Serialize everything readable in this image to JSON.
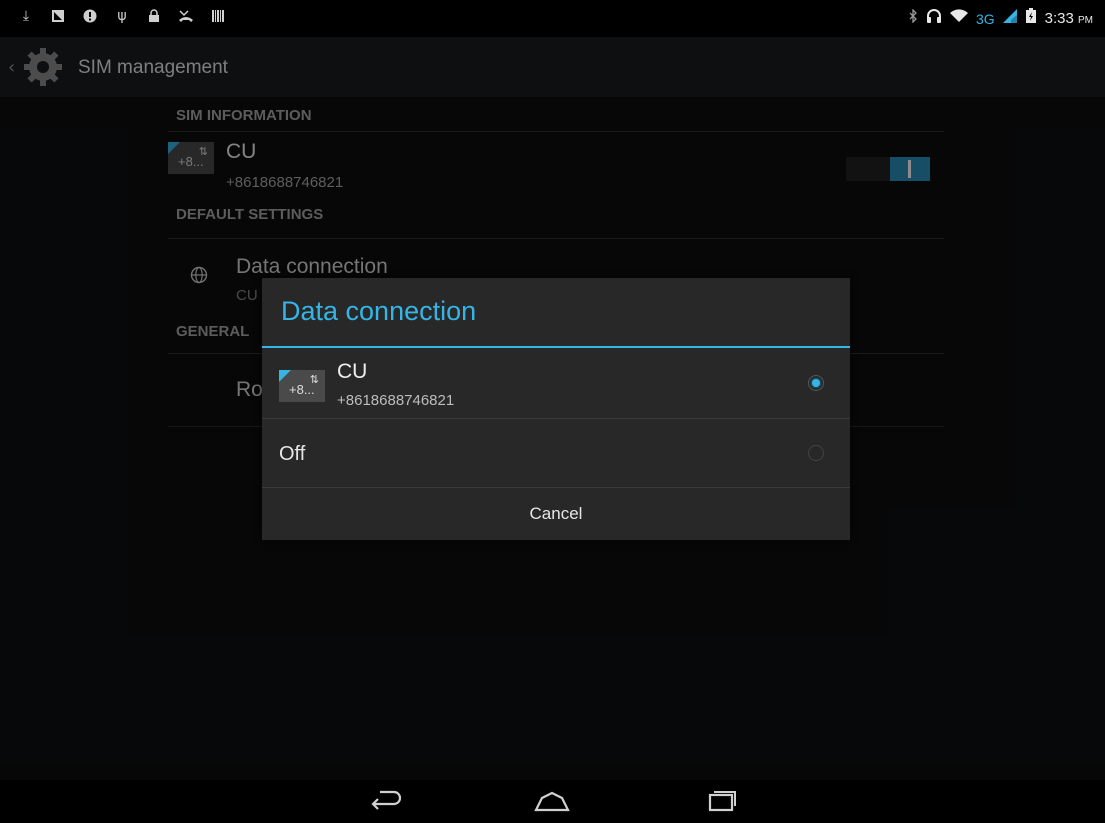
{
  "status_bar": {
    "left_icons": [
      "download-icon",
      "notification-icon",
      "alert-icon",
      "usb-icon",
      "lock-icon",
      "missed-call-icon",
      "barcode-icon"
    ],
    "network_type": "3G",
    "time": "3:33",
    "ampm": "PM"
  },
  "action_bar": {
    "title": "SIM management"
  },
  "sections": {
    "sim_information": "SIM INFORMATION",
    "default_settings": "DEFAULT SETTINGS",
    "general": "GENERAL"
  },
  "sim": {
    "badge": "+8...",
    "name": "CU",
    "number": "+8618688746821",
    "enabled": true
  },
  "data_connection_pref": {
    "title": "Data connection",
    "value": "CU"
  },
  "roaming_partial": "Ro",
  "dialog": {
    "title": "Data connection",
    "options": [
      {
        "badge": "+8...",
        "name": "CU",
        "number": "+8618688746821",
        "selected": true
      },
      {
        "label": "Off",
        "selected": false
      }
    ],
    "cancel_label": "Cancel"
  },
  "colors": {
    "accent": "#34b5e5",
    "toggle_on": "#2a8fb8",
    "background": "#0d0e10"
  }
}
